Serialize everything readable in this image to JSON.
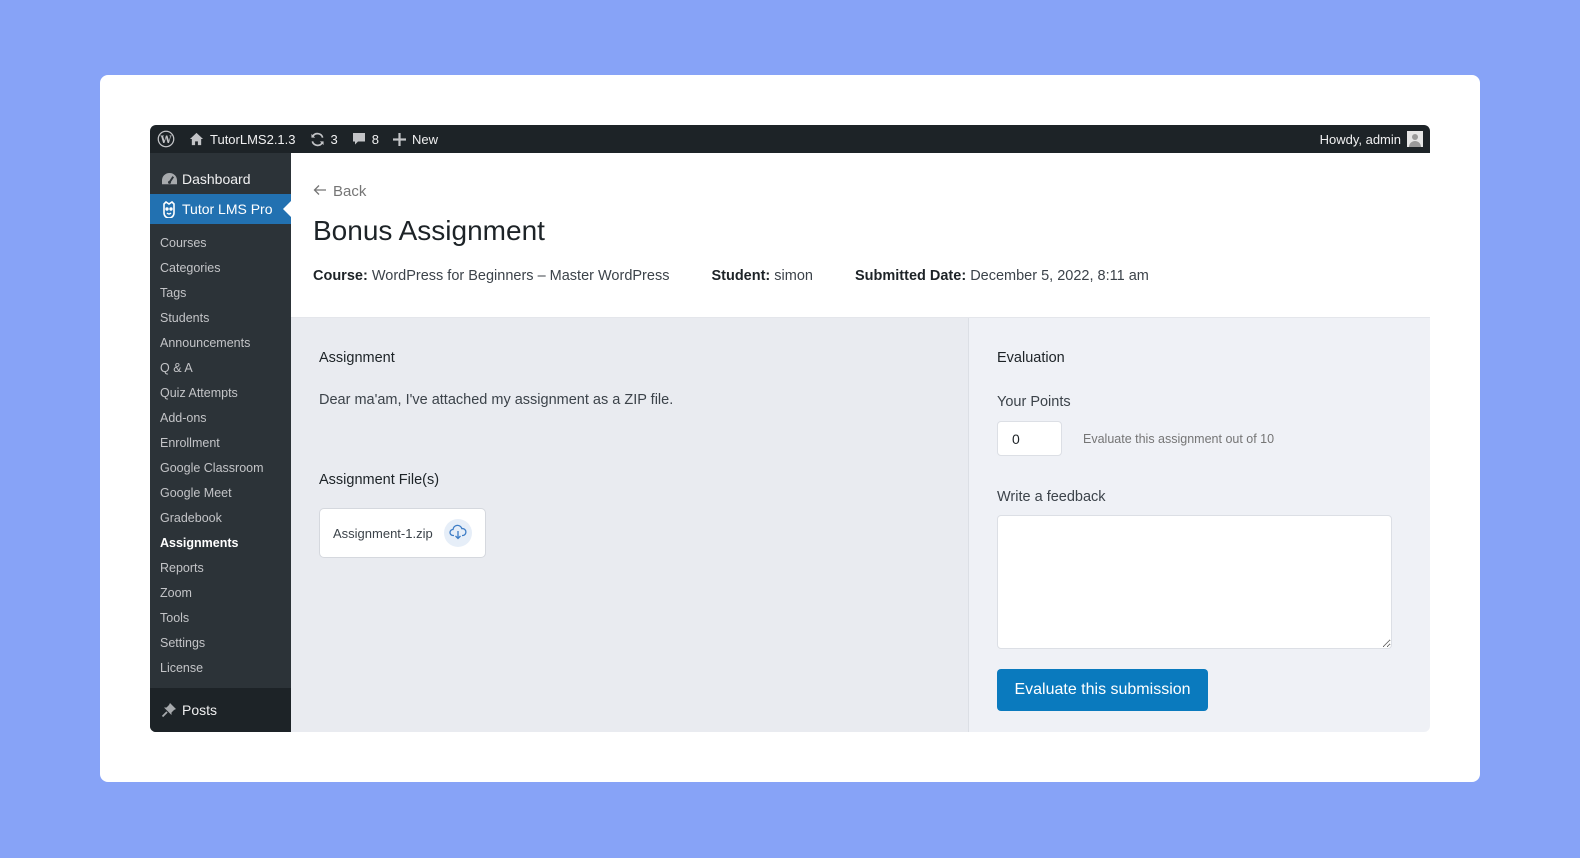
{
  "adminbar": {
    "site_name": "TutorLMS2.1.3",
    "updates_count": "3",
    "comments_count": "8",
    "new_label": "New",
    "howdy": "Howdy, admin"
  },
  "sidebar": {
    "dashboard": "Dashboard",
    "tutor": "Tutor LMS Pro",
    "items": [
      {
        "label": "Courses"
      },
      {
        "label": "Categories"
      },
      {
        "label": "Tags"
      },
      {
        "label": "Students"
      },
      {
        "label": "Announcements"
      },
      {
        "label": "Q & A"
      },
      {
        "label": "Quiz Attempts"
      },
      {
        "label": "Add-ons"
      },
      {
        "label": "Enrollment"
      },
      {
        "label": "Google Classroom"
      },
      {
        "label": "Google Meet"
      },
      {
        "label": "Gradebook"
      },
      {
        "label": "Assignments"
      },
      {
        "label": "Reports"
      },
      {
        "label": "Zoom"
      },
      {
        "label": "Tools"
      },
      {
        "label": "Settings"
      },
      {
        "label": "License"
      }
    ],
    "current_item": "Assignments",
    "posts": "Posts"
  },
  "header": {
    "back": "Back",
    "title": "Bonus Assignment",
    "course_label": "Course:",
    "course_value": "WordPress for Beginners – Master WordPress",
    "student_label": "Student:",
    "student_value": "simon",
    "date_label": "Submitted Date:",
    "date_value": "December 5, 2022, 8:11 am"
  },
  "assignment": {
    "heading": "Assignment",
    "text": "Dear ma'am, I've attached my assignment as a ZIP file.",
    "files_heading": "Assignment File(s)",
    "file_name": "Assignment-1.zip"
  },
  "evaluation": {
    "heading": "Evaluation",
    "points_label": "Your Points",
    "points_value": "0",
    "points_hint": "Evaluate this assignment out of 10",
    "feedback_label": "Write a feedback",
    "feedback_value": "",
    "submit_label": "Evaluate this submission"
  },
  "colors": {
    "page_bg": "#87a3f7",
    "adminbar_bg": "#1d2327",
    "sidebar_bg": "#2c3338",
    "active_menu": "#2271b1",
    "primary_button": "#0a7abe"
  }
}
